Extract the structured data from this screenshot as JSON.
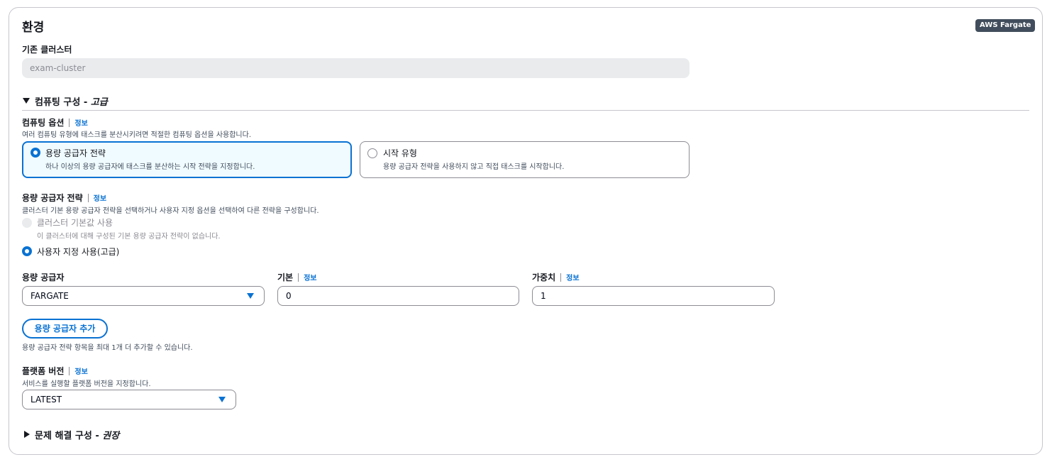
{
  "section": {
    "title": "환경",
    "badge": "AWS Fargate"
  },
  "existing_cluster": {
    "label": "기존 클러스터",
    "value": "exam-cluster"
  },
  "compute_config": {
    "title": "컴퓨팅 구성",
    "title_sep": " - ",
    "title_suffix": "고급",
    "options_label": "컴퓨팅 옵션",
    "info": "정보",
    "options_desc": "여러 컴퓨팅 유형에 태스크를 분산시키려면 적절한 컴퓨팅 옵션을 사용합니다.",
    "tiles": [
      {
        "title": "용량 공급자 전략",
        "desc": "하나 이상의 용량 공급자에 태스크를 분산하는 시작 전략을 지정합니다.",
        "selected": true
      },
      {
        "title": "시작 유형",
        "desc": "용량 공급자 전략을 사용하지 않고 직접 태스크를 시작합니다.",
        "selected": false
      }
    ]
  },
  "strategy": {
    "label": "용량 공급자 전략",
    "info": "정보",
    "desc": "클러스터 기본 용량 공급자 전략을 선택하거나 사용자 지정 옵션을 선택하여 다른 전략을 구성합니다.",
    "options": [
      {
        "label": "클러스터 기본값 사용",
        "desc": "이 클러스터에 대해 구성된 기본 용량 공급자 전략이 없습니다.",
        "disabled": true,
        "checked": false
      },
      {
        "label": "사용자 지정 사용(고급)",
        "desc": "",
        "disabled": false,
        "checked": true
      }
    ]
  },
  "provider_row": {
    "provider_label": "용량 공급자",
    "provider_value": "FARGATE",
    "base_label": "기본",
    "base_info": "정보",
    "base_value": "0",
    "weight_label": "가중치",
    "weight_info": "정보",
    "weight_value": "1"
  },
  "add_provider": {
    "button": "용량 공급자 추가",
    "hint": "용량 공급자 전략 항목을 최대 1개 더 추가할 수 있습니다."
  },
  "platform": {
    "label": "플랫폼 버전",
    "info": "정보",
    "desc": "서비스를 실행할 플랫폼 버전을 지정합니다.",
    "value": "LATEST"
  },
  "troubleshooting": {
    "title": "문제 해결 구성",
    "title_sep": " - ",
    "title_suffix": "권장"
  }
}
